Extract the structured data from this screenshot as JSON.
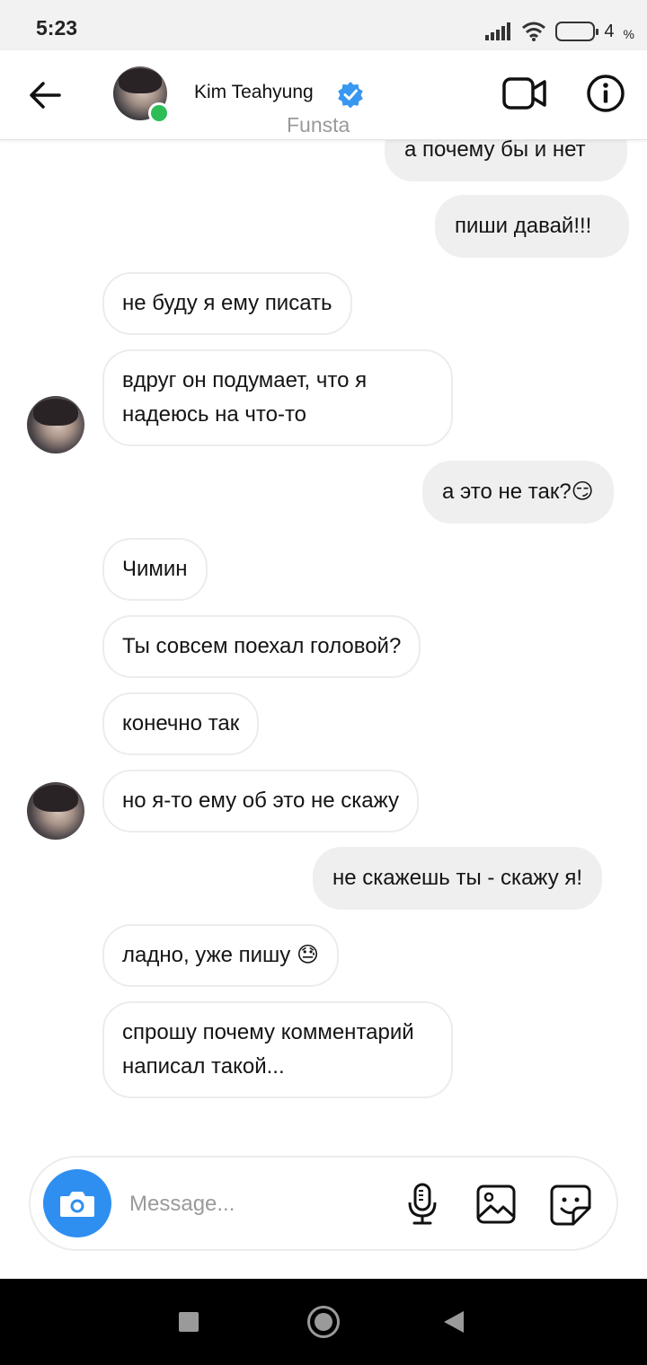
{
  "status_bar": {
    "time": "5:23",
    "battery_level": "4",
    "battery_unit": "%",
    "icons": [
      "signal-icon",
      "wifi-icon",
      "battery-icon"
    ]
  },
  "header": {
    "name": "Kim Teahyung",
    "subtitle": "Funsta",
    "online": true,
    "verified": true,
    "accent_color": "#3897f0",
    "online_color": "#2dbd56"
  },
  "messages": [
    {
      "side": "out",
      "text": "а почему бы и нет"
    },
    {
      "side": "out",
      "text": "пиши давай!!!"
    },
    {
      "side": "in",
      "text": "не буду я ему писать"
    },
    {
      "side": "in",
      "text": "вдруг он подумает, что я надеюсь на что-то",
      "avatar": true
    },
    {
      "side": "out",
      "text": "а это не так?😏"
    },
    {
      "side": "in",
      "text": "Чимин"
    },
    {
      "side": "in",
      "text": "Ты совсем поехал головой?"
    },
    {
      "side": "in",
      "text": "конечно так"
    },
    {
      "side": "in",
      "text": "но я-то ему об это не скажу",
      "avatar": true
    },
    {
      "side": "out",
      "text": "не скажешь ты - скажу я!"
    },
    {
      "side": "in",
      "text": "ладно, уже пишу 😓"
    },
    {
      "side": "in",
      "text": "спрошу почему комментарий написал такой..."
    }
  ],
  "composer": {
    "placeholder": "Message...",
    "value": "",
    "camera_color": "#2f8ff1"
  }
}
